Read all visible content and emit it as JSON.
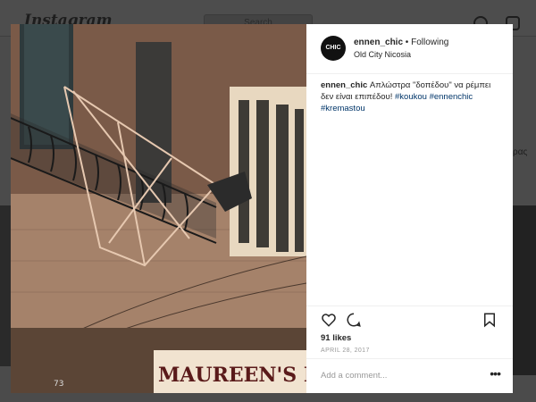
{
  "background": {
    "logo": "Instagram",
    "search_placeholder": "Search",
    "side_text": "ρας"
  },
  "post": {
    "username": "ennen_chic",
    "separator": " • ",
    "follow_status": "Following",
    "location": "Old City Nicosia",
    "avatar_text": "CHIC",
    "caption_user": "ennen_chic",
    "caption_text": " Απλώστρα \"δοπέδου\" να ρέμπει δεν είναι επιπέδου! ",
    "hashtags": [
      "#koukou",
      "#ennenchic",
      "#kremastou"
    ],
    "likes": "91 likes",
    "date": "APRIL 28, 2017",
    "comment_placeholder": "Add a comment...",
    "more_label": "•••"
  },
  "photo": {
    "sign_text": "MAUREEN'S NAIL",
    "house_number": "73"
  },
  "icons": {
    "like": "heart-icon",
    "comment": "comment-icon",
    "save": "bookmark-icon"
  }
}
